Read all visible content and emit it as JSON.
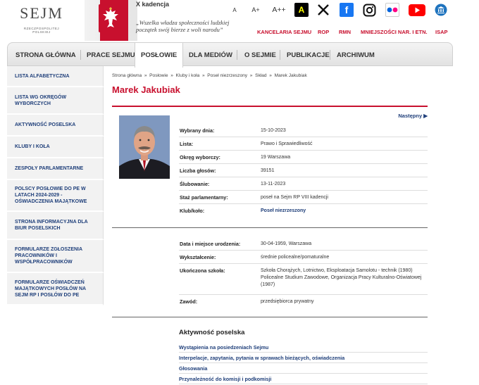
{
  "header": {
    "logo_word": "SEJM",
    "logo_sub": "RZECZPOSPOLITEJ POLSKIEJ",
    "kadencja": "X kadencja",
    "motto": "„Wszelka władza społeczności ludzkiej początek swój bierze z woli narodu”",
    "font_small": "A",
    "font_medium": "A+",
    "font_large": "A++",
    "contrast": "A",
    "top_links": [
      "KANCELARIA SEJMU",
      "ROP",
      "RMN",
      "MNIEJSZOŚCI NAR. I ETN.",
      "ISAP"
    ],
    "colors": {
      "accent": "#c8102e",
      "link": "#1f3f7a"
    }
  },
  "nav": {
    "items": [
      "STRONA GŁÓWNA",
      "PRACE SEJMU",
      "POSŁOWIE",
      "DLA MEDIÓW",
      "O SEJMIE",
      "PUBLIKACJE",
      "ARCHIWUM"
    ],
    "active": "POSŁOWIE"
  },
  "sidebar": {
    "items": [
      "LISTA ALFABETYCZNA",
      "LISTA WG OKRĘGÓW WYBORCZYCH",
      "AKTYWNOŚĆ POSELSKA",
      "KLUBY I KOŁA",
      "ZESPOŁY PARLAMENTARNE",
      "POLSCY POSŁOWIE DO PE W LATACH 2024-2029 - OŚWIADCZENIA MAJĄTKOWE",
      "STRONA INFORMACYJNA DLA BIUR POSELSKICH",
      "FORMULARZE ZGŁOSZENIA PRACOWNIKÓW I WSPÓŁPRACOWNIKÓW",
      "FORMULARZE OŚWIADCZEŃ MAJĄTKOWYCH POSŁÓW NA SEJM RP I POSŁÓW DO PE"
    ]
  },
  "main": {
    "breadcrumbs": [
      "Strona główna",
      "Posłowie",
      "Kluby i koła",
      "Poseł niezrzeszony",
      "Skład",
      "Marek Jakubiak"
    ],
    "title": "Marek Jakubiak",
    "next_label": "Następny ▶",
    "details": [
      {
        "label": "Wybrany dnia:",
        "value": "15-10-2023"
      },
      {
        "label": "Lista:",
        "value": "Prawo i Sprawiedliwość"
      },
      {
        "label": "Okręg wyborczy:",
        "value": "19  Warszawa"
      },
      {
        "label": "Liczba głosów:",
        "value": "39151"
      },
      {
        "label": "Ślubowanie:",
        "value": "13-11-2023"
      },
      {
        "label": "Staż parlamentarny:",
        "value": "poseł na Sejm RP VIII kadencji"
      },
      {
        "label": "Klub/koło:",
        "value": "Poseł niezrzeszony"
      }
    ],
    "personal": [
      {
        "label": "Data i miejsce urodzenia:",
        "value": "30-04-1959, Warszawa"
      },
      {
        "label": "Wykształcenie:",
        "value": "średnie policealne/pomaturalne"
      },
      {
        "label": "Ukończona szkoła:",
        "value": "Szkoła Chorążych, Lotnictwo, Eksploatacja Samolotu - technik (1980) Policealne Studium Zawodowe, Organizacja Pracy Kulturalno-Oświatowej (1987)"
      },
      {
        "label": "Zawód:",
        "value": "przedsiębiorca prywatny"
      }
    ],
    "activity_title": "Aktywność poselska",
    "activity_links": [
      "Wystąpienia na posiedzeniach Sejmu",
      "Interpelacje, zapytania, pytania w sprawach bieżących, oświadczenia",
      "Głosowania",
      "Przynależność do komisji i podkomisji"
    ]
  }
}
